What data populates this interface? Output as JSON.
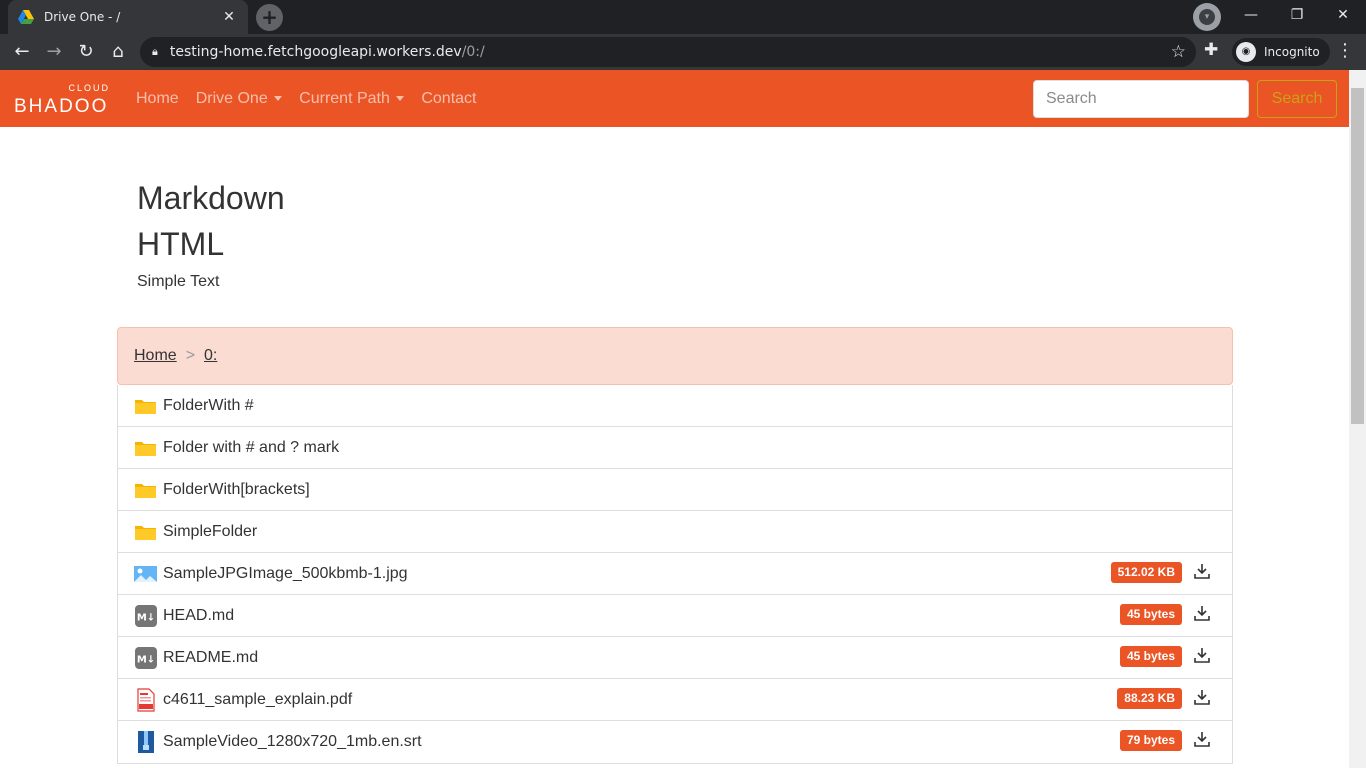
{
  "browser": {
    "tab_title": "Drive One - /",
    "url_host": "testing-home.fetchgoogleapi.workers.dev",
    "url_path": "/0:/",
    "profile_label": "Incognito"
  },
  "navbar": {
    "brand_top": "CLOUD",
    "brand_main": "BHADOO",
    "links": {
      "home": "Home",
      "drive": "Drive One",
      "current_path": "Current Path",
      "contact": "Contact"
    },
    "search_placeholder": "Search",
    "search_button": "Search"
  },
  "readme": {
    "heading1": "Markdown",
    "heading2": "HTML",
    "text": "Simple Text"
  },
  "breadcrumb": {
    "home": "Home",
    "separator": ">",
    "current": "0:"
  },
  "files": [
    {
      "name": "FolderWith #",
      "icon": "folder-icon"
    },
    {
      "name": "Folder with # and ? mark",
      "icon": "folder-icon"
    },
    {
      "name": "FolderWith[brackets]",
      "icon": "folder-icon"
    },
    {
      "name": "SimpleFolder",
      "icon": "folder-icon"
    },
    {
      "name": "SampleJPGImage_500kbmb-1.jpg",
      "icon": "image-file-icon",
      "size": "512.02 KB"
    },
    {
      "name": "HEAD.md",
      "icon": "markdown-file-icon",
      "size": "45 bytes"
    },
    {
      "name": "README.md",
      "icon": "markdown-file-icon",
      "size": "45 bytes"
    },
    {
      "name": "c4611_sample_explain.pdf",
      "icon": "pdf-file-icon",
      "size": "88.23 KB"
    },
    {
      "name": "SampleVideo_1280x720_1mb.en.srt",
      "icon": "zip-file-icon",
      "size": "79 bytes"
    }
  ],
  "colors": {
    "navbar": "#eb5424",
    "badge": "#eb5424",
    "breadcrumb_bg": "#fadcd3"
  }
}
